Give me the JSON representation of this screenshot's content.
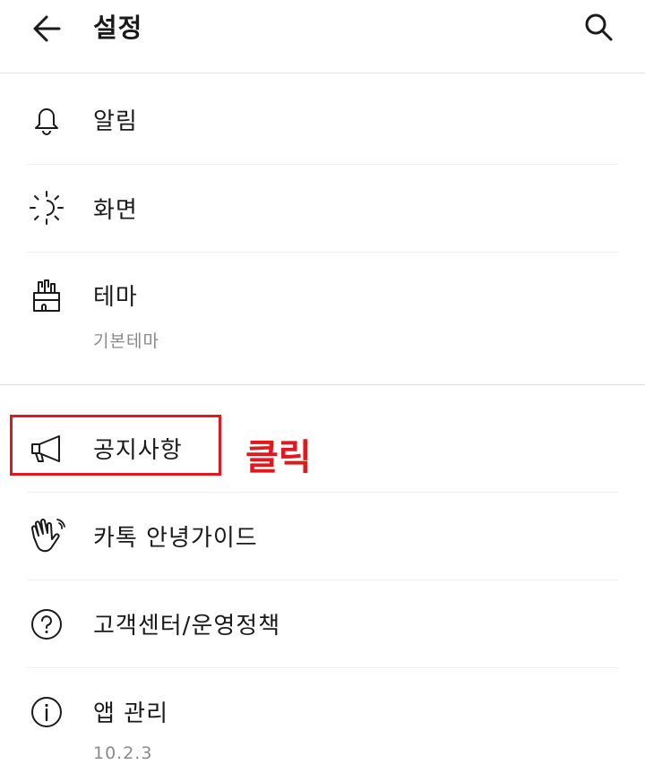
{
  "header": {
    "title": "설정"
  },
  "menu": {
    "items": [
      {
        "label": "알림"
      },
      {
        "label": "화면"
      },
      {
        "label": "테마",
        "sub": "기본테마"
      },
      {
        "label": "공지사항"
      },
      {
        "label": "카톡 안녕가이드"
      },
      {
        "label": "고객센터/운영정책"
      },
      {
        "label": "앱 관리",
        "sub": "10.2.3"
      }
    ]
  },
  "annotation": {
    "text": "클릭",
    "color": "#e0191f"
  }
}
